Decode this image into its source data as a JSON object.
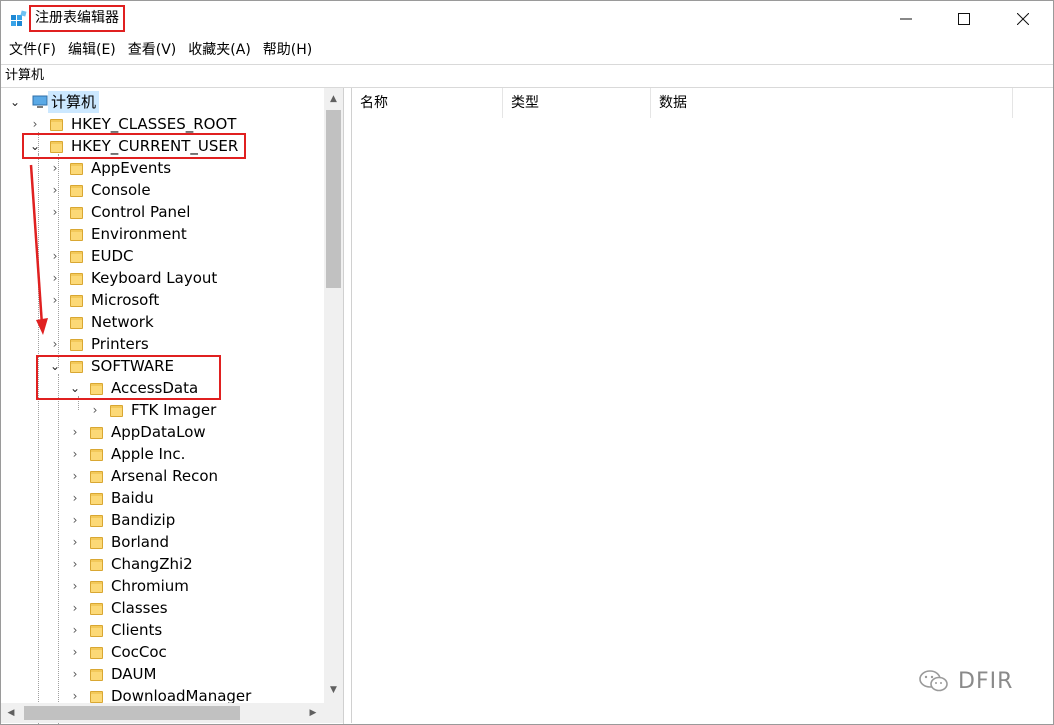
{
  "window": {
    "title": "注册表编辑器",
    "minimize_glyph": "—",
    "maximize_glyph": "☐",
    "close_glyph": "✕"
  },
  "menu": [
    {
      "label": "文件(F)"
    },
    {
      "label": "编辑(E)"
    },
    {
      "label": "查看(V)"
    },
    {
      "label": "收藏夹(A)"
    },
    {
      "label": "帮助(H)"
    }
  ],
  "address": {
    "path": "计算机"
  },
  "tree": {
    "root": "计算机",
    "hkcr": "HKEY_CLASSES_ROOT",
    "hkcu": "HKEY_CURRENT_USER",
    "hkcu_children": [
      "AppEvents",
      "Console",
      "Control Panel",
      "Environment",
      "EUDC",
      "Keyboard Layout",
      "Microsoft",
      "Network",
      "Printers"
    ],
    "software": "SOFTWARE",
    "accessdata": "AccessData",
    "ftk": "FTK Imager",
    "software_children": [
      "AppDataLow",
      "Apple Inc.",
      "Arsenal Recon",
      "Baidu",
      "Bandizip",
      "Borland",
      "ChangZhi2",
      "Chromium",
      "Classes",
      "Clients",
      "CocCoc",
      "DAUM",
      "DownloadManager"
    ]
  },
  "list": {
    "columns": [
      "名称",
      "类型",
      "数据"
    ]
  },
  "watermark": {
    "text": "DFIR",
    "icon": "wechat-icon"
  },
  "colors": {
    "highlight_red": "#e02020",
    "selection_blue": "#cce8ff",
    "folder_yellow": "#f3c95a"
  }
}
